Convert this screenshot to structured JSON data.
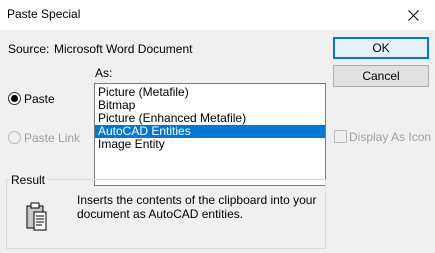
{
  "window": {
    "title": "Paste Special"
  },
  "source": {
    "label": "Source:",
    "value": "Microsoft Word Document"
  },
  "as_label": "As:",
  "options": {
    "paste": {
      "label": "Paste",
      "checked": true
    },
    "paste_link": {
      "label": "Paste Link",
      "enabled": false
    }
  },
  "list": {
    "items": [
      "Picture (Metafile)",
      "Bitmap",
      "Picture (Enhanced Metafile)",
      "AutoCAD Entities",
      "Image Entity"
    ],
    "selected_index": 3
  },
  "buttons": {
    "ok": "OK",
    "cancel": "Cancel"
  },
  "display_as_icon": {
    "label": "Display As Icon",
    "checked": false,
    "enabled": false
  },
  "result": {
    "label": "Result",
    "line1": "Inserts the contents of the clipboard into your",
    "line2": "document as AutoCAD entities.",
    "icon": "clipboard-icon"
  },
  "colors": {
    "selection": "#0078d7",
    "default_button_border": "#0078d7"
  }
}
